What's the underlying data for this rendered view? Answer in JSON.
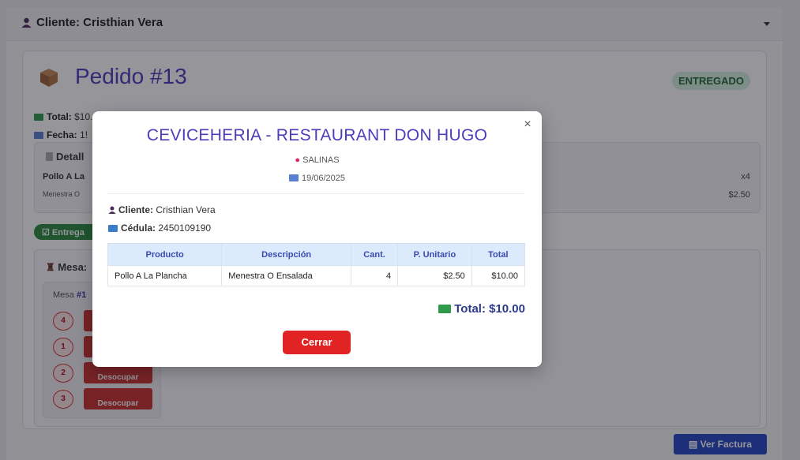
{
  "header": {
    "title": "Cliente: Cristhian Vera"
  },
  "order": {
    "title": "Pedido #13",
    "status": "ENTREGADO",
    "total_label": "Total:",
    "total_value": "$10.00",
    "fecha_label": "Fecha:",
    "fecha_value": "1!"
  },
  "details": {
    "heading": "Detall",
    "product": "Pollo A La",
    "description": "Menestra O",
    "qty": "x4",
    "price": "$2.50"
  },
  "delivered_pill": "Entrega",
  "mesas": {
    "heading": "Mesa:",
    "mesa_prefix": "Mesa",
    "mesa_number": "#1",
    "seats": [
      "4",
      "1",
      "2",
      "3"
    ],
    "release_label": "Desocupar"
  },
  "ver_factura": "Ver Factura",
  "modal": {
    "restaurant": "CEVICEHERIA - RESTAURANT DON HUGO",
    "location": "SALINAS",
    "date": "19/06/2025",
    "cliente_label": "Cliente:",
    "cliente_value": "Cristhian Vera",
    "cedula_label": "Cédula:",
    "cedula_value": "2450109190",
    "table_headers": [
      "Producto",
      "Descripción",
      "Cant.",
      "P. Unitario",
      "Total"
    ],
    "rows": [
      [
        "Pollo A La Plancha",
        "Menestra O Ensalada",
        "4",
        "$2.50",
        "$10.00"
      ]
    ],
    "total": "Total: $10.00",
    "close_label": "Cerrar",
    "close_x": "×"
  },
  "colors": {
    "accent": "#4b3dbb",
    "danger": "#e22323",
    "primary": "#2645c4",
    "success": "#2b8a3e"
  }
}
